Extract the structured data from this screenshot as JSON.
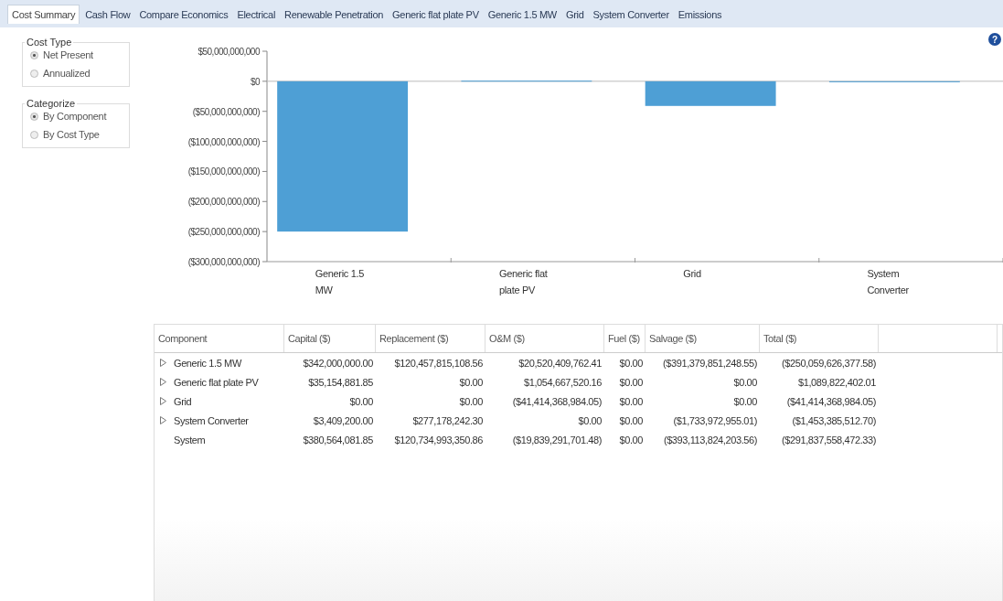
{
  "tabs": [
    {
      "label": "Cost Summary",
      "selected": true
    },
    {
      "label": "Cash Flow",
      "selected": false
    },
    {
      "label": "Compare Economics",
      "selected": false
    },
    {
      "label": "Electrical",
      "selected": false
    },
    {
      "label": "Renewable Penetration",
      "selected": false
    },
    {
      "label": "Generic flat plate PV",
      "selected": false
    },
    {
      "label": "Generic 1.5 MW",
      "selected": false
    },
    {
      "label": "Grid",
      "selected": false
    },
    {
      "label": "System Converter",
      "selected": false
    },
    {
      "label": "Emissions",
      "selected": false
    }
  ],
  "help_button": {
    "label": "?"
  },
  "cost_type": {
    "title": "Cost Type",
    "options": [
      {
        "label": "Net Present",
        "selected": true
      },
      {
        "label": "Annualized",
        "selected": false
      }
    ]
  },
  "categorize": {
    "title": "Categorize",
    "options": [
      {
        "label": "By Component",
        "selected": true
      },
      {
        "label": "By Cost Type",
        "selected": false
      }
    ]
  },
  "chart_data": {
    "type": "bar",
    "categories": [
      "Generic 1.5 MW",
      "Generic flat plate PV",
      "Grid",
      "System Converter"
    ],
    "values": [
      -250000000000,
      1000000000,
      -41000000000,
      -1000000000
    ],
    "color": "#4e9fd5",
    "ylim": [
      -300000000000,
      50000000000
    ],
    "yticks": [
      {
        "value": 50000000000,
        "label": "$50,000,000,000"
      },
      {
        "value": 0,
        "label": "$0"
      },
      {
        "value": -50000000000,
        "label": "($50,000,000,000)"
      },
      {
        "value": -100000000000,
        "label": "($100,000,000,000)"
      },
      {
        "value": -150000000000,
        "label": "($150,000,000,000)"
      },
      {
        "value": -200000000000,
        "label": "($200,000,000,000)"
      },
      {
        "value": -250000000000,
        "label": "($250,000,000,000)"
      },
      {
        "value": -300000000000,
        "label": "($300,000,000,000)"
      }
    ]
  },
  "table": {
    "columns": [
      "Component",
      "Capital ($)",
      "Replacement ($)",
      "O&M ($)",
      "Fuel ($)",
      "Salvage ($)",
      "Total ($)"
    ],
    "rows": [
      {
        "kind": "group",
        "cells": [
          "Generic 1.5 MW",
          "$342,000,000.00",
          "$120,457,815,108.56",
          "$20,520,409,762.41",
          "$0.00",
          "($391,379,851,248.55)",
          "($250,059,626,377.58)"
        ]
      },
      {
        "kind": "group",
        "cells": [
          "Generic flat plate PV",
          "$35,154,881.85",
          "$0.00",
          "$1,054,667,520.16",
          "$0.00",
          "$0.00",
          "$1,089,822,402.01"
        ]
      },
      {
        "kind": "group",
        "cells": [
          "Grid",
          "$0.00",
          "$0.00",
          "($41,414,368,984.05)",
          "$0.00",
          "$0.00",
          "($41,414,368,984.05)"
        ]
      },
      {
        "kind": "group",
        "cells": [
          "System Converter",
          "$3,409,200.00",
          "$277,178,242.30",
          "$0.00",
          "$0.00",
          "($1,733,972,955.01)",
          "($1,453,385,512.70)"
        ]
      },
      {
        "kind": "total",
        "cells": [
          "System",
          "$380,564,081.85",
          "$120,734,993,350.86",
          "($19,839,291,701.48)",
          "$0.00",
          "($393,113,824,203.56)",
          "($291,837,558,472.33)"
        ]
      }
    ]
  }
}
